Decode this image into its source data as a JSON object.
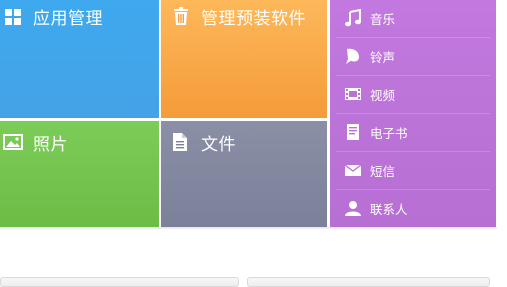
{
  "tiles": {
    "apps": {
      "label": "应用管理",
      "icon": "grid-icon",
      "color": "#45a2e6"
    },
    "preinstall": {
      "label": "管理预装软件",
      "icon": "trash-icon",
      "color": "#f7a443"
    },
    "photos": {
      "label": "照片",
      "icon": "photo-icon",
      "color": "#72c34c"
    },
    "files": {
      "label": "文件",
      "icon": "file-icon",
      "color": "#82879e"
    }
  },
  "media": {
    "color": "#bb72d8",
    "items": [
      {
        "label": "音乐",
        "icon": "music-note-icon"
      },
      {
        "label": "铃声",
        "icon": "ringtone-icon"
      },
      {
        "label": "视频",
        "icon": "video-film-icon"
      },
      {
        "label": "电子书",
        "icon": "ebook-icon"
      },
      {
        "label": "短信",
        "icon": "envelope-icon"
      },
      {
        "label": "联系人",
        "icon": "contact-person-icon"
      }
    ]
  }
}
